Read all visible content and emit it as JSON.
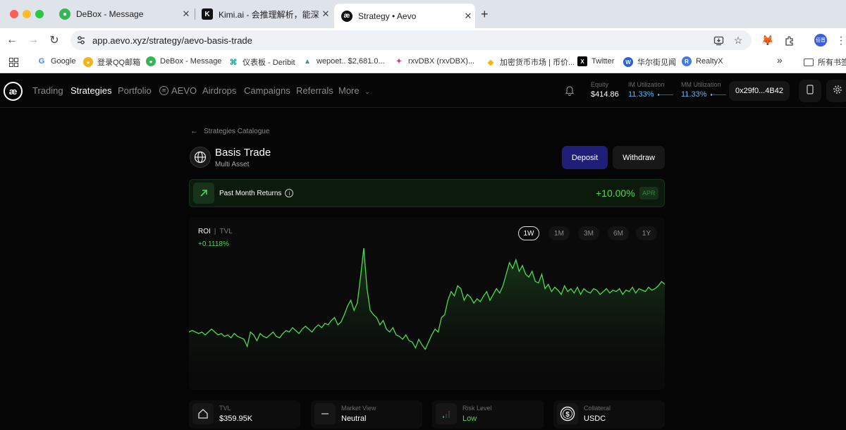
{
  "browser": {
    "tabs": [
      {
        "title": "DeBox - Message",
        "favicon": "debox-icon"
      },
      {
        "title": "Kimi.ai - 会推理解析，能深度思",
        "favicon": "kimi-icon"
      },
      {
        "title": "Strategy • Aevo",
        "favicon": "aevo-icon",
        "active": true
      }
    ],
    "new_tab": "+",
    "url": "app.aevo.xyz/strategy/aevo-basis-trade",
    "profile": "佰晋",
    "bookmarks": [
      {
        "label": "Google",
        "icon": "google-icon"
      },
      {
        "label": "登录QQ邮箱",
        "icon": "qq-mail-icon"
      },
      {
        "label": "DeBox - Message",
        "icon": "debox-icon"
      },
      {
        "label": "仪表板 - Deribit",
        "icon": "deribit-icon"
      },
      {
        "label": "wepoet.. $2,681.0...",
        "icon": "wepoet-icon"
      },
      {
        "label": "rxvDBX (rxvDBX)...",
        "icon": "rxvdbx-icon"
      },
      {
        "label": "加密货币市场 | 币价...",
        "icon": "binance-icon"
      },
      {
        "label": "Twitter",
        "icon": "x-icon"
      },
      {
        "label": "华尔街见闻",
        "icon": "wallstreetcn-icon"
      },
      {
        "label": "RealtyX",
        "icon": "realtyx-icon"
      }
    ],
    "all_bookmarks": "所有书签",
    "more_bookmarks": "»"
  },
  "nav": {
    "logo": "æ",
    "links": [
      "Trading",
      "Strategies",
      "Portfolio",
      "AEVO",
      "Airdrops",
      "Campaigns",
      "Referrals",
      "More"
    ],
    "active": "Strategies",
    "equity_label": "Equity",
    "equity_value": "$414.86",
    "im_label": "IM Utilization",
    "im_value": "11.33%",
    "mm_label": "MM Utilization",
    "mm_value": "11.33%",
    "utilization_fraction": 0.1133,
    "wallet": "0x29f0...4B42"
  },
  "strategy": {
    "breadcrumb": "Strategies Catalogue",
    "title": "Basis Trade",
    "subtitle": "Multi Asset",
    "deposit": "Deposit",
    "withdraw": "Withdraw",
    "returns_label": "Past Month Returns",
    "returns_value": "+10.00%",
    "returns_badge": "APR"
  },
  "chart": {
    "metric_on": "ROI",
    "separator": "|",
    "metric_off": "TVL",
    "value": "+0.1118%",
    "ranges": [
      "1W",
      "1M",
      "3M",
      "6M",
      "1Y"
    ],
    "active_range": "1W",
    "line_color": "#4ed94e"
  },
  "chart_data": {
    "type": "area",
    "title": "",
    "xlabel": "",
    "ylabel": "",
    "grid": false,
    "series": [
      {
        "values": [
          0.4,
          0.41,
          0.4,
          0.39,
          0.4,
          0.38,
          0.4,
          0.42,
          0.4,
          0.38,
          0.39,
          0.37,
          0.38,
          0.36,
          0.39,
          0.37,
          0.36,
          0.35,
          0.3,
          0.4,
          0.38,
          0.34,
          0.39,
          0.37,
          0.36,
          0.38,
          0.4,
          0.37,
          0.36,
          0.39,
          0.41,
          0.4,
          0.43,
          0.41,
          0.39,
          0.42,
          0.44,
          0.42,
          0.4,
          0.43,
          0.45,
          0.43,
          0.46,
          0.45,
          0.48,
          0.5,
          0.45,
          0.47,
          0.52,
          0.58,
          0.62,
          0.55,
          0.6,
          0.78,
          0.98,
          0.7,
          0.55,
          0.52,
          0.5,
          0.45,
          0.48,
          0.42,
          0.4,
          0.43,
          0.38,
          0.37,
          0.35,
          0.38,
          0.34,
          0.33,
          0.29,
          0.35,
          0.31,
          0.28,
          0.33,
          0.38,
          0.42,
          0.4,
          0.5,
          0.52,
          0.62,
          0.68,
          0.65,
          0.72,
          0.7,
          0.62,
          0.66,
          0.64,
          0.6,
          0.63,
          0.61,
          0.65,
          0.68,
          0.62,
          0.66,
          0.7,
          0.67,
          0.72,
          0.8,
          0.88,
          0.84,
          0.9,
          0.82,
          0.86,
          0.8,
          0.78,
          0.82,
          0.75,
          0.74,
          0.8,
          0.7,
          0.73,
          0.68,
          0.71,
          0.69,
          0.66,
          0.72,
          0.68,
          0.7,
          0.67,
          0.71,
          0.66,
          0.7,
          0.68,
          0.67,
          0.7,
          0.69,
          0.66,
          0.68,
          0.7,
          0.67,
          0.69,
          0.68,
          0.7,
          0.66,
          0.69,
          0.68,
          0.71,
          0.67,
          0.7,
          0.69,
          0.68,
          0.71,
          0.69,
          0.7,
          0.72,
          0.75,
          0.73
        ]
      }
    ]
  },
  "stats": [
    {
      "label": "TVL",
      "value": "$359.95K",
      "icon": "vault-icon"
    },
    {
      "label": "Market View",
      "value": "Neutral",
      "icon": "neutral-dash-icon"
    },
    {
      "label": "Risk Level",
      "value": "Low",
      "icon": "signal-bars-icon",
      "status_color": "#4ed94e"
    },
    {
      "label": "Collateral",
      "value": "USDC",
      "icon": "usdc-icon"
    }
  ]
}
